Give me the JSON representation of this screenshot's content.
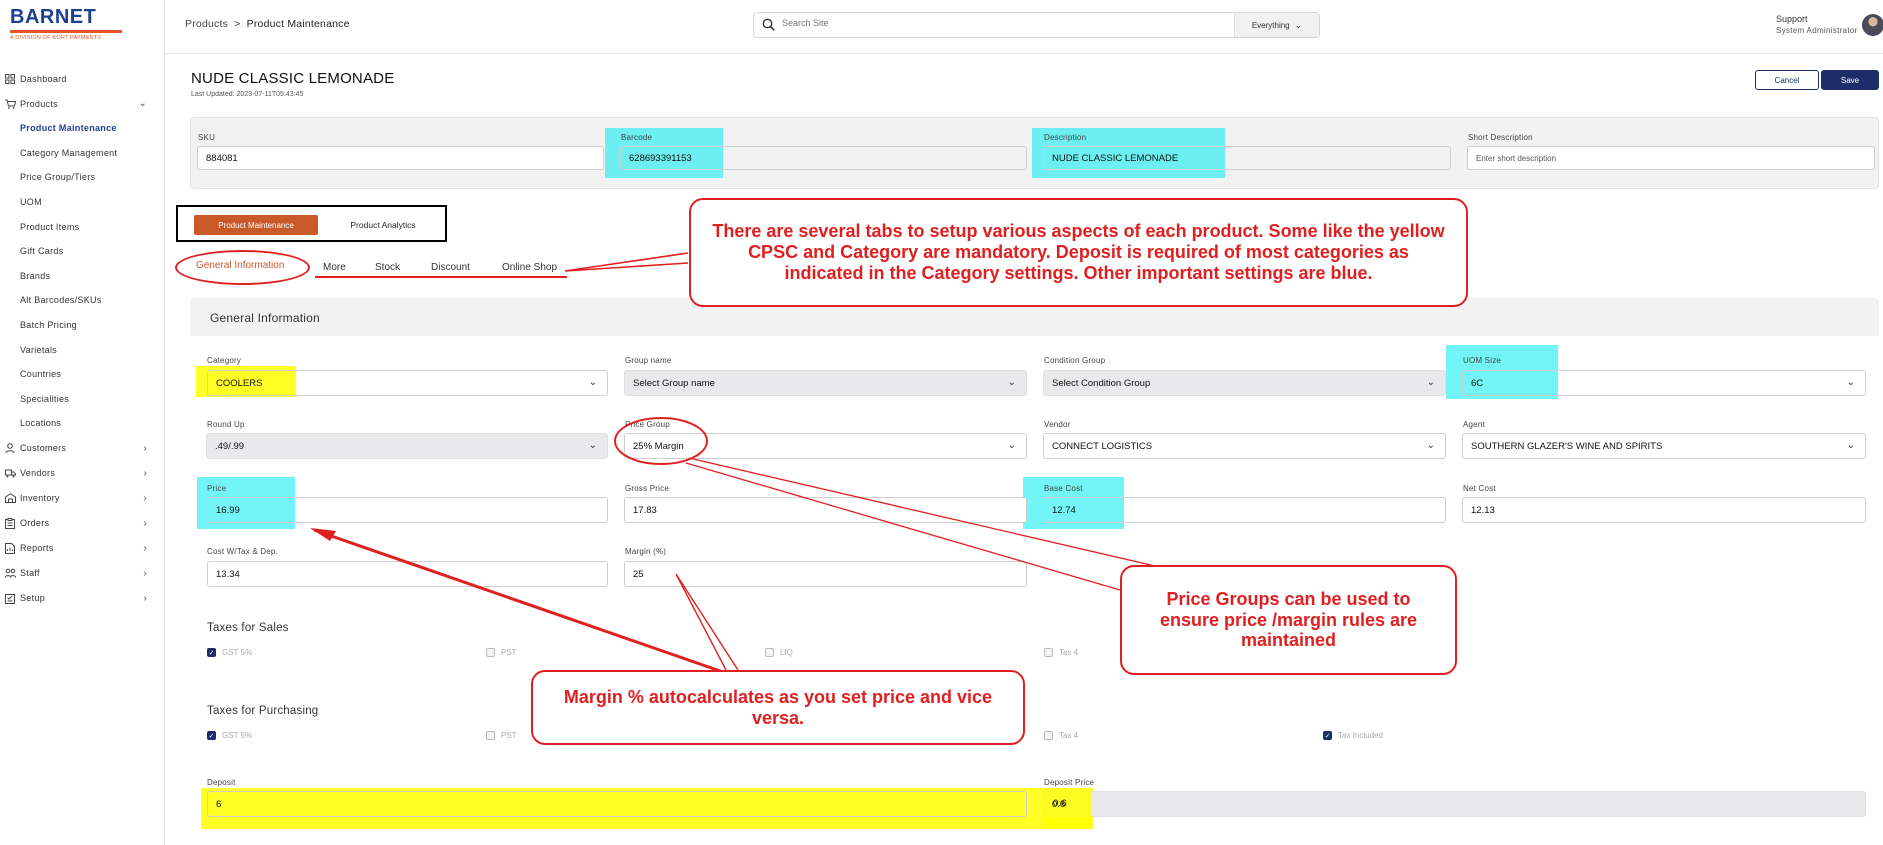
{
  "brand": {
    "name": "BARNET",
    "tagline": "A DIVISION OF KORT PAYMENTS"
  },
  "sidebar": {
    "items": [
      {
        "label": "Dashboard",
        "icon": "grid-icon"
      },
      {
        "label": "Products",
        "icon": "cart-icon",
        "expanded": true
      }
    ],
    "sub_items": [
      {
        "label": "Product Maintenance",
        "active": true
      },
      {
        "label": "Category Management"
      },
      {
        "label": "Price Group/Tiers"
      },
      {
        "label": "UOM"
      },
      {
        "label": "Product Items"
      },
      {
        "label": "Gift Cards"
      },
      {
        "label": "Brands"
      },
      {
        "label": "Alt Barcodes/SKUs"
      },
      {
        "label": "Batch Pricing"
      },
      {
        "label": "Varietals"
      },
      {
        "label": "Countries"
      },
      {
        "label": "Specialities"
      },
      {
        "label": "Locations"
      }
    ],
    "bottom_items": [
      {
        "label": "Customers",
        "icon": "person-icon"
      },
      {
        "label": "Vendors",
        "icon": "truck-icon"
      },
      {
        "label": "Inventory",
        "icon": "warehouse-icon"
      },
      {
        "label": "Orders",
        "icon": "clipboard-icon"
      },
      {
        "label": "Reports",
        "icon": "report-icon"
      },
      {
        "label": "Staff",
        "icon": "staff-icon"
      },
      {
        "label": "Setup",
        "icon": "setup-icon"
      }
    ]
  },
  "topbar": {
    "breadcrumb": {
      "parent": "Products",
      "separator": ">",
      "current": "Product Maintenance"
    },
    "search": {
      "placeholder": "Search Site",
      "scope": "Everything"
    },
    "user": {
      "name": "Support",
      "role": "System Administrator"
    }
  },
  "page": {
    "title": "NUDE CLASSIC LEMONADE",
    "last_updated": "Last Updated: 2023-07-11T05:43:45",
    "cancel_label": "Cancel",
    "save_label": "Save"
  },
  "top_fields": {
    "sku": {
      "label": "SKU",
      "value": "884081"
    },
    "barcode": {
      "label": "Barcode",
      "value": "628693391153"
    },
    "description": {
      "label": "Description",
      "value": "NUDE CLASSIC LEMONADE"
    },
    "short_description": {
      "label": "Short Description",
      "placeholder": "Enter short description"
    }
  },
  "main_tabs": {
    "active": "Product Maintenance",
    "other": "Product Analytics"
  },
  "sub_tabs": [
    "General Information",
    "More",
    "Stock",
    "Discount",
    "Online Shop"
  ],
  "general": {
    "title": "General Information",
    "category": {
      "label": "Category",
      "value": "COOLERS"
    },
    "group_name": {
      "label": "Group name",
      "value": "Select Group name"
    },
    "condition_group": {
      "label": "Condition Group",
      "value": "Select Condition Group"
    },
    "uom_size": {
      "label": "UOM Size",
      "value": "6C"
    },
    "round_up": {
      "label": "Round Up",
      "value": ".49/.99"
    },
    "price_group": {
      "label": "Price Group",
      "value": "25% Margin"
    },
    "vendor": {
      "label": "Vendor",
      "value": "CONNECT LOGISTICS"
    },
    "agent": {
      "label": "Agent",
      "value": "SOUTHERN GLAZER'S WINE AND SPIRITS"
    },
    "price": {
      "label": "Price",
      "value": "16.99"
    },
    "gross_price": {
      "label": "Gross Price",
      "value": "17.83"
    },
    "base_cost": {
      "label": "Base Cost",
      "value": "12.74"
    },
    "net_cost": {
      "label": "Net Cost",
      "value": "12.13"
    },
    "cost_tax_dep": {
      "label": "Cost W/Tax & Dep.",
      "value": "13.34"
    },
    "margin": {
      "label": "Margin (%)",
      "value": "25"
    },
    "taxes_sales": {
      "title": "Taxes for Sales",
      "items": [
        {
          "label": "GST 5%",
          "checked": true
        },
        {
          "label": "PST",
          "checked": false
        },
        {
          "label": "LIQ",
          "checked": false
        },
        {
          "label": "Tax 4",
          "checked": false
        }
      ]
    },
    "taxes_purchasing": {
      "title": "Taxes for Purchasing",
      "items": [
        {
          "label": "GST 5%",
          "checked": true
        },
        {
          "label": "PST",
          "checked": false
        },
        {
          "label": "Tax 4",
          "checked": false
        },
        {
          "label": "Tax Included",
          "checked": true
        }
      ]
    },
    "deposit": {
      "label": "Deposit",
      "value": "6"
    },
    "deposit_price": {
      "label": "Deposit Price",
      "value": "0.6"
    }
  },
  "annotations": {
    "tabs_note": "There are several tabs to setup various aspects of each product. Some like the yellow CPSC and Category are mandatory. Deposit is required of most categories as indicated in the Category settings. Other important settings are blue.",
    "price_group_note": "Price Groups can be used to ensure price /margin rules are maintained",
    "margin_note": "Margin % autocalculates as you set price and vice versa."
  },
  "colors": {
    "brand": "#1d3f8f",
    "accent": "#c85a2a",
    "annotation": "#e02020",
    "primary_button": "#1d2d6a"
  }
}
